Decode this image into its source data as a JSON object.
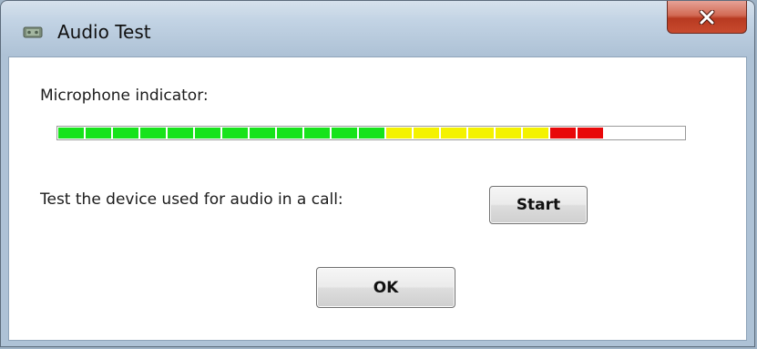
{
  "window": {
    "title": "Audio Test"
  },
  "icons": {
    "app": "audio-device-icon",
    "close": "close-icon"
  },
  "microphone": {
    "label": "Microphone indicator:",
    "level_segments_lit": 20,
    "level_segments_total": 23,
    "colors": {
      "green": "#17e31b",
      "yellow": "#f4f200",
      "red": "#e8080a",
      "empty": "#ffffff"
    }
  },
  "test": {
    "label": "Test the device used for audio in a call:",
    "start_label": "Start"
  },
  "dialog": {
    "ok_label": "OK"
  }
}
